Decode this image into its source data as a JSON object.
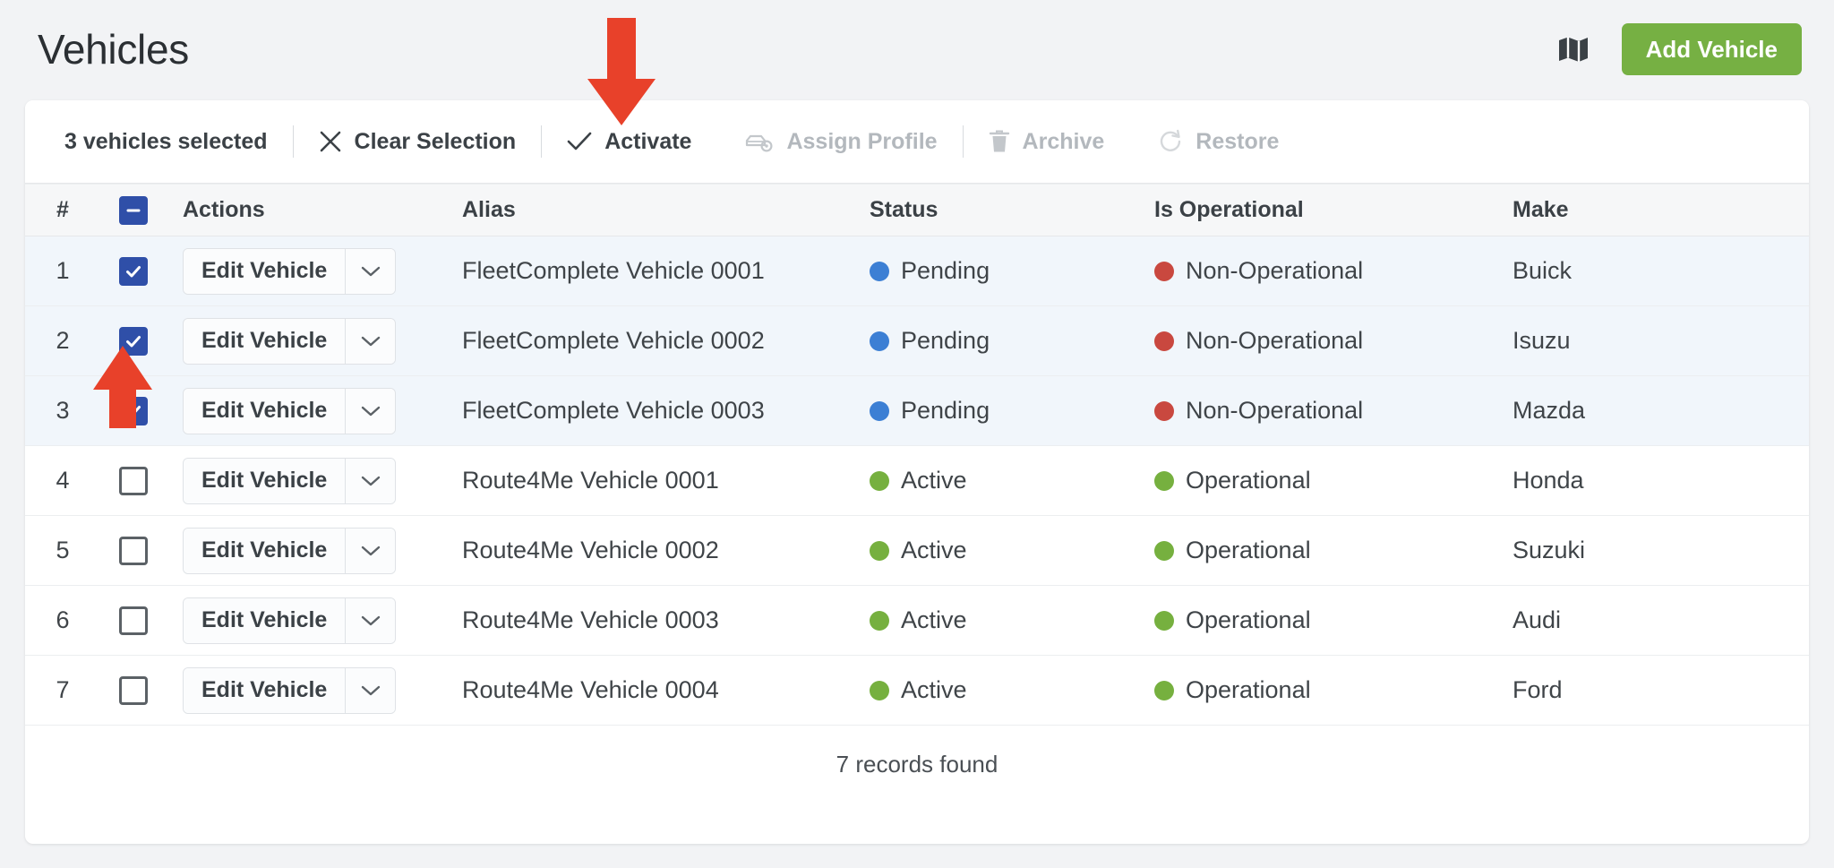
{
  "header": {
    "title": "Vehicles",
    "map_icon": "map-icon",
    "add_button_label": "Add Vehicle",
    "add_button_color": "#76b043"
  },
  "selection_toolbar": {
    "count_label": "3 vehicles selected",
    "actions": [
      {
        "label": "Clear Selection",
        "icon": "close-x-icon",
        "disabled": false
      },
      {
        "label": "Activate",
        "icon": "check-icon",
        "disabled": false
      },
      {
        "label": "Assign Profile",
        "icon": "vehicle-gear-icon",
        "disabled": true
      },
      {
        "label": "Archive",
        "icon": "trash-icon",
        "disabled": true
      },
      {
        "label": "Restore",
        "icon": "refresh-icon",
        "disabled": true
      }
    ]
  },
  "table": {
    "header_checkbox_state": "indeterminate",
    "columns": [
      "#",
      "",
      "Actions",
      "Alias",
      "Status",
      "Is Operational",
      "Make"
    ],
    "row_action_label": "Edit Vehicle",
    "rows": [
      {
        "num": "1",
        "checked": true,
        "alias": "FleetComplete Vehicle 0001",
        "status": "Pending",
        "status_color": "#3c7fd4",
        "operational": "Non-Operational",
        "operational_color": "#c9483f",
        "make": "Buick"
      },
      {
        "num": "2",
        "checked": true,
        "alias": "FleetComplete Vehicle 0002",
        "status": "Pending",
        "status_color": "#3c7fd4",
        "operational": "Non-Operational",
        "operational_color": "#c9483f",
        "make": "Isuzu"
      },
      {
        "num": "3",
        "checked": true,
        "alias": "FleetComplete Vehicle 0003",
        "status": "Pending",
        "status_color": "#3c7fd4",
        "operational": "Non-Operational",
        "operational_color": "#c9483f",
        "make": "Mazda"
      },
      {
        "num": "4",
        "checked": false,
        "alias": "Route4Me Vehicle 0001",
        "status": "Active",
        "status_color": "#76b03f",
        "operational": "Operational",
        "operational_color": "#76b03f",
        "make": "Honda"
      },
      {
        "num": "5",
        "checked": false,
        "alias": "Route4Me Vehicle 0002",
        "status": "Active",
        "status_color": "#76b03f",
        "operational": "Operational",
        "operational_color": "#76b03f",
        "make": "Suzuki"
      },
      {
        "num": "6",
        "checked": false,
        "alias": "Route4Me Vehicle 0003",
        "status": "Active",
        "status_color": "#76b03f",
        "operational": "Operational",
        "operational_color": "#76b03f",
        "make": "Audi"
      },
      {
        "num": "7",
        "checked": false,
        "alias": "Route4Me Vehicle 0004",
        "status": "Active",
        "status_color": "#76b03f",
        "operational": "Operational",
        "operational_color": "#76b03f",
        "make": "Ford"
      }
    ]
  },
  "footer": {
    "records_label": "7 records found"
  },
  "annotations": {
    "arrow_color": "#e8412a",
    "arrow_down_target": "Activate",
    "arrow_up_target": "row-3-checkbox"
  }
}
